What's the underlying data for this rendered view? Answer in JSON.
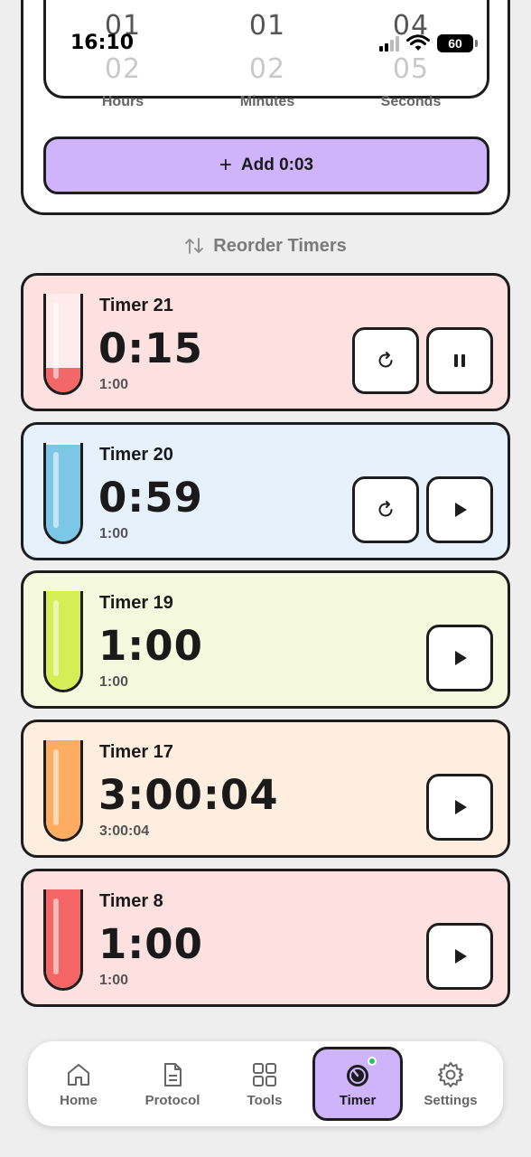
{
  "status_bar": {
    "time": "16:10",
    "battery": "60"
  },
  "picker": {
    "columns": [
      {
        "value_current": "01",
        "value_next": "02",
        "label": "Hours"
      },
      {
        "value_current": "01",
        "value_next": "02",
        "label": "Minutes"
      },
      {
        "value_current": "04",
        "value_next": "05",
        "label": "Seconds"
      }
    ]
  },
  "add_button": {
    "label": "Add 0:03"
  },
  "reorder": {
    "label": "Reorder Timers"
  },
  "timers": [
    {
      "name": "Timer 21",
      "time": "0:15",
      "sub": "1:00",
      "bg": "#fde0e0",
      "fill": "#f26868",
      "level": 0.25,
      "running": true
    },
    {
      "name": "Timer 20",
      "time": "0:59",
      "sub": "1:00",
      "bg": "#e6f1fb",
      "fill": "#7cc6e6",
      "level": 0.98,
      "running": false
    },
    {
      "name": "Timer 19",
      "time": "1:00",
      "sub": "1:00",
      "bg": "#f5fade",
      "fill": "#d6ee55",
      "level": 1.0,
      "running": false
    },
    {
      "name": "Timer 17",
      "time": "3:00:04",
      "sub": "3:00:04",
      "bg": "#fdeedf",
      "fill": "#ffac63",
      "level": 1.0,
      "running": false
    },
    {
      "name": "Timer 8",
      "time": "1:00",
      "sub": "1:00",
      "bg": "#fde0e0",
      "fill": "#f46565",
      "level": 1.0,
      "running": false
    }
  ],
  "nav": {
    "items": [
      {
        "label": "Home",
        "icon": "home-icon"
      },
      {
        "label": "Protocol",
        "icon": "document-icon"
      },
      {
        "label": "Tools",
        "icon": "grid-icon"
      },
      {
        "label": "Timer",
        "icon": "timer-icon",
        "active": true
      },
      {
        "label": "Settings",
        "icon": "gear-icon"
      }
    ]
  },
  "colors": {
    "accent": "#cfb4fb",
    "border": "#1d1d1d",
    "background": "#eeeeee",
    "notify_dot": "#22c55e"
  }
}
